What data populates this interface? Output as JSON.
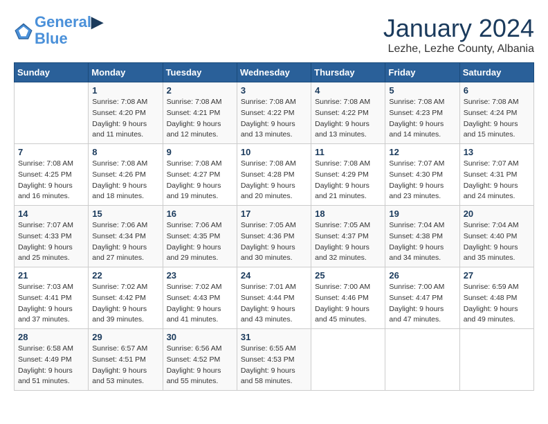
{
  "header": {
    "logo_line1": "General",
    "logo_line2": "Blue",
    "month_title": "January 2024",
    "subtitle": "Lezhe, Lezhe County, Albania"
  },
  "weekdays": [
    "Sunday",
    "Monday",
    "Tuesday",
    "Wednesday",
    "Thursday",
    "Friday",
    "Saturday"
  ],
  "weeks": [
    [
      {
        "day": "",
        "info": ""
      },
      {
        "day": "1",
        "info": "Sunrise: 7:08 AM\nSunset: 4:20 PM\nDaylight: 9 hours\nand 11 minutes."
      },
      {
        "day": "2",
        "info": "Sunrise: 7:08 AM\nSunset: 4:21 PM\nDaylight: 9 hours\nand 12 minutes."
      },
      {
        "day": "3",
        "info": "Sunrise: 7:08 AM\nSunset: 4:22 PM\nDaylight: 9 hours\nand 13 minutes."
      },
      {
        "day": "4",
        "info": "Sunrise: 7:08 AM\nSunset: 4:22 PM\nDaylight: 9 hours\nand 13 minutes."
      },
      {
        "day": "5",
        "info": "Sunrise: 7:08 AM\nSunset: 4:23 PM\nDaylight: 9 hours\nand 14 minutes."
      },
      {
        "day": "6",
        "info": "Sunrise: 7:08 AM\nSunset: 4:24 PM\nDaylight: 9 hours\nand 15 minutes."
      }
    ],
    [
      {
        "day": "7",
        "info": ""
      },
      {
        "day": "8",
        "info": "Sunrise: 7:08 AM\nSunset: 4:26 PM\nDaylight: 9 hours\nand 18 minutes."
      },
      {
        "day": "9",
        "info": "Sunrise: 7:08 AM\nSunset: 4:27 PM\nDaylight: 9 hours\nand 19 minutes."
      },
      {
        "day": "10",
        "info": "Sunrise: 7:08 AM\nSunset: 4:28 PM\nDaylight: 9 hours\nand 20 minutes."
      },
      {
        "day": "11",
        "info": "Sunrise: 7:08 AM\nSunset: 4:29 PM\nDaylight: 9 hours\nand 21 minutes."
      },
      {
        "day": "12",
        "info": "Sunrise: 7:07 AM\nSunset: 4:30 PM\nDaylight: 9 hours\nand 23 minutes."
      },
      {
        "day": "13",
        "info": "Sunrise: 7:07 AM\nSunset: 4:31 PM\nDaylight: 9 hours\nand 24 minutes."
      }
    ],
    [
      {
        "day": "14",
        "info": ""
      },
      {
        "day": "15",
        "info": "Sunrise: 7:06 AM\nSunset: 4:34 PM\nDaylight: 9 hours\nand 27 minutes."
      },
      {
        "day": "16",
        "info": "Sunrise: 7:06 AM\nSunset: 4:35 PM\nDaylight: 9 hours\nand 29 minutes."
      },
      {
        "day": "17",
        "info": "Sunrise: 7:05 AM\nSunset: 4:36 PM\nDaylight: 9 hours\nand 30 minutes."
      },
      {
        "day": "18",
        "info": "Sunrise: 7:05 AM\nSunset: 4:37 PM\nDaylight: 9 hours\nand 32 minutes."
      },
      {
        "day": "19",
        "info": "Sunrise: 7:04 AM\nSunset: 4:38 PM\nDaylight: 9 hours\nand 34 minutes."
      },
      {
        "day": "20",
        "info": "Sunrise: 7:04 AM\nSunset: 4:40 PM\nDaylight: 9 hours\nand 35 minutes."
      }
    ],
    [
      {
        "day": "21",
        "info": ""
      },
      {
        "day": "22",
        "info": "Sunrise: 7:02 AM\nSunset: 4:42 PM\nDaylight: 9 hours\nand 39 minutes."
      },
      {
        "day": "23",
        "info": "Sunrise: 7:02 AM\nSunset: 4:43 PM\nDaylight: 9 hours\nand 41 minutes."
      },
      {
        "day": "24",
        "info": "Sunrise: 7:01 AM\nSunset: 4:44 PM\nDaylight: 9 hours\nand 43 minutes."
      },
      {
        "day": "25",
        "info": "Sunrise: 7:00 AM\nSunset: 4:46 PM\nDaylight: 9 hours\nand 45 minutes."
      },
      {
        "day": "26",
        "info": "Sunrise: 7:00 AM\nSunset: 4:47 PM\nDaylight: 9 hours\nand 47 minutes."
      },
      {
        "day": "27",
        "info": "Sunrise: 6:59 AM\nSunset: 4:48 PM\nDaylight: 9 hours\nand 49 minutes."
      }
    ],
    [
      {
        "day": "28",
        "info": "Sunrise: 6:58 AM\nSunset: 4:49 PM\nDaylight: 9 hours\nand 51 minutes."
      },
      {
        "day": "29",
        "info": "Sunrise: 6:57 AM\nSunset: 4:51 PM\nDaylight: 9 hours\nand 53 minutes."
      },
      {
        "day": "30",
        "info": "Sunrise: 6:56 AM\nSunset: 4:52 PM\nDaylight: 9 hours\nand 55 minutes."
      },
      {
        "day": "31",
        "info": "Sunrise: 6:55 AM\nSunset: 4:53 PM\nDaylight: 9 hours\nand 58 minutes."
      },
      {
        "day": "",
        "info": ""
      },
      {
        "day": "",
        "info": ""
      },
      {
        "day": "",
        "info": ""
      }
    ]
  ],
  "week1_sun": {
    "day": "7",
    "info": "Sunrise: 7:08 AM\nSunset: 4:25 PM\nDaylight: 9 hours\nand 16 minutes."
  },
  "week2_sun": {
    "day": "14",
    "info": "Sunrise: 7:07 AM\nSunset: 4:33 PM\nDaylight: 9 hours\nand 25 minutes."
  },
  "week3_sun": {
    "day": "21",
    "info": "Sunrise: 7:03 AM\nSunset: 4:41 PM\nDaylight: 9 hours\nand 37 minutes."
  }
}
